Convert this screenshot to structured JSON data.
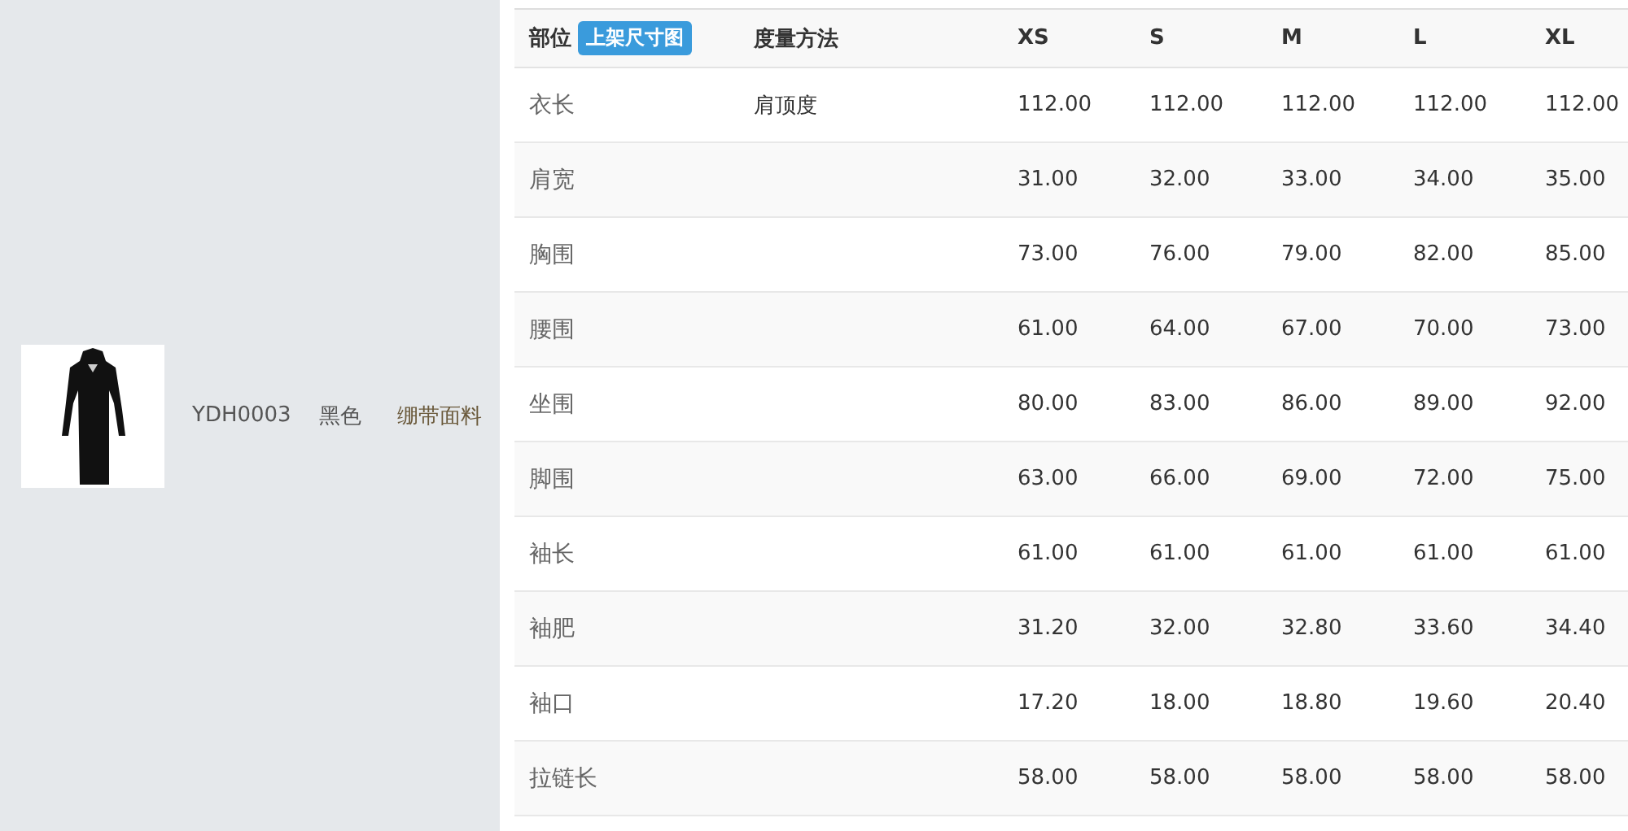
{
  "product": {
    "code": "YDH0003",
    "color_name": "黑色",
    "material": "绷带面料"
  },
  "table": {
    "columns": [
      {
        "label": "部位",
        "badge": "上架尺寸图"
      },
      {
        "label": "度量方法"
      },
      {
        "label": "XS"
      },
      {
        "label": "S"
      },
      {
        "label": "M"
      },
      {
        "label": "L"
      },
      {
        "label": "XL"
      }
    ],
    "rows": [
      {
        "part": "衣长",
        "method": "肩顶度",
        "values": [
          "112.00",
          "112.00",
          "112.00",
          "112.00",
          "112.00"
        ]
      },
      {
        "part": "肩宽",
        "values": [
          "31.00",
          "32.00",
          "33.00",
          "34.00",
          "35.00"
        ]
      },
      {
        "part": "胸围",
        "values": [
          "73.00",
          "76.00",
          "79.00",
          "82.00",
          "85.00"
        ]
      },
      {
        "part": "腰围",
        "values": [
          "61.00",
          "64.00",
          "67.00",
          "70.00",
          "73.00"
        ]
      },
      {
        "part": "坐围",
        "values": [
          "80.00",
          "83.00",
          "86.00",
          "89.00",
          "92.00"
        ]
      },
      {
        "part": "脚围",
        "values": [
          "63.00",
          "66.00",
          "69.00",
          "72.00",
          "75.00"
        ]
      },
      {
        "part": "袖长",
        "values": [
          "61.00",
          "61.00",
          "61.00",
          "61.00",
          "61.00"
        ]
      },
      {
        "part": "袖肥",
        "values": [
          "31.20",
          "32.00",
          "32.80",
          "33.60",
          "34.40"
        ]
      },
      {
        "part": "袖口",
        "values": [
          "17.20",
          "18.00",
          "18.80",
          "19.60",
          "20.40"
        ]
      },
      {
        "part": "拉链长",
        "values": [
          "58.00",
          "58.00",
          "58.00",
          "58.00",
          "58.00"
        ]
      }
    ]
  }
}
